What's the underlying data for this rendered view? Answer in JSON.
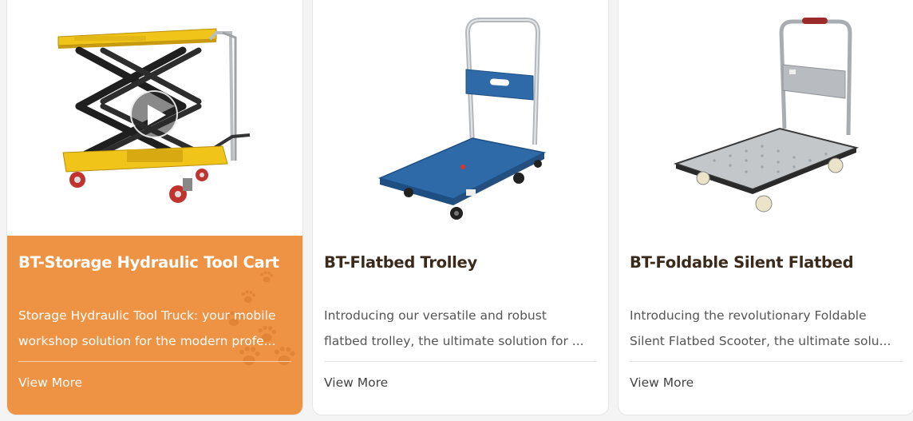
{
  "cards": [
    {
      "title": "BT-Storage Hydraulic Tool Cart",
      "desc_line1": "Storage Hydraulic Tool Truck: your mobile",
      "desc_line2": "workshop solution for the modern profe...",
      "link": "View More",
      "image": "hydraulic-scissor-lift-cart",
      "has_video": true
    },
    {
      "title": "BT-Flatbed Trolley",
      "desc_line1": "Introducing our versatile and robust",
      "desc_line2": "flatbed trolley, the ultimate solution for ...",
      "link": "View More",
      "image": "blue-flatbed-trolley"
    },
    {
      "title": "BT-Foldable Silent Flatbed",
      "desc_line1": "Introducing the revolutionary Foldable",
      "desc_line2": "Silent Flatbed Scooter, the ultimate solu...",
      "link": "View More",
      "image": "steel-foldable-flatbed"
    }
  ],
  "colors": {
    "active_card": "#ee9243",
    "title_text": "#3a2a1c",
    "body_text": "#555555"
  }
}
